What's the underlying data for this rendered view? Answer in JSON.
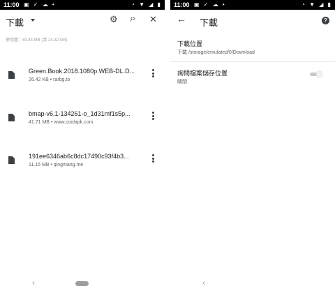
{
  "status_bar": {
    "time": "11:00",
    "left_icons": "▣ ✓ ☁ •",
    "right_icons": "◔ ▼ ◢ ▮"
  },
  "downloads_screen": {
    "title": "下載",
    "usage": "使用量：50.44 MB (共 24.32 GB)",
    "items": [
      {
        "name": "Green.Book.2018.1080p.WEB-DL.D...",
        "meta": "26.42 KB • rarbg.to"
      },
      {
        "name": "bmap-v6.1-134261-o_1d31mf1s5p...",
        "meta": "41.71 MB • www.coolapk.com"
      },
      {
        "name": "191ee6346ab6c8dc17490c93f4b3...",
        "meta": "11.15 MB • qingmang.me"
      }
    ]
  },
  "settings_screen": {
    "title": "下載",
    "location": {
      "label": "下載位置",
      "value": "下載 /storage/emulated/0/Download"
    },
    "ask_location": {
      "label": "詢問檔案儲存位置",
      "value": "關閉",
      "enabled": false
    }
  },
  "icons": {
    "settings": "⚙",
    "search": "⌕",
    "close": "✕",
    "back": "←",
    "help": "?",
    "nav_back": "‹"
  },
  "colors": {
    "status_bar": "#000000",
    "text_primary": "#202124",
    "text_secondary": "#5f6368",
    "icon": "#3c4043"
  }
}
